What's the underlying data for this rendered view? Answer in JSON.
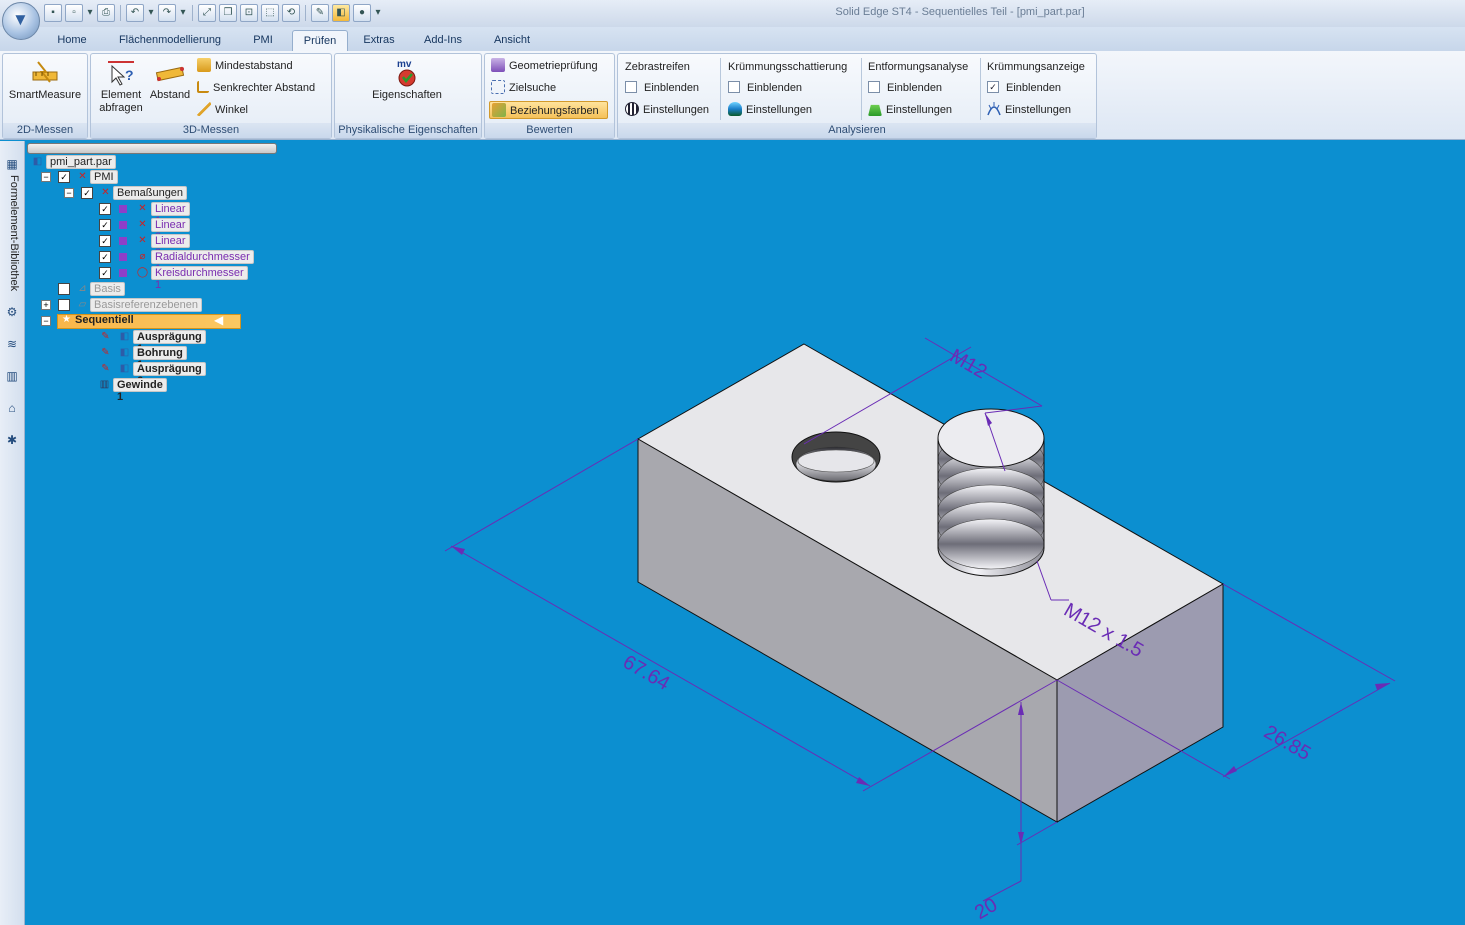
{
  "window": {
    "title": "Solid Edge ST4 - Sequentielles Teil - [pmi_part.par]"
  },
  "quick_access": [
    "save-icon",
    "save-as-icon",
    "dropdown-icon",
    "print-icon",
    "undo-icon",
    "redo-icon",
    "fit-icon",
    "window-icon",
    "zoom-icon",
    "view-icon",
    "sketch-icon",
    "part-icon",
    "stop-icon",
    "dropdown-icon"
  ],
  "tabs": [
    {
      "label": "Home"
    },
    {
      "label": "Flächenmodellierung"
    },
    {
      "label": "PMI"
    },
    {
      "label": "Prüfen"
    },
    {
      "label": "Extras"
    },
    {
      "label": "Add-Ins"
    },
    {
      "label": "Ansicht"
    }
  ],
  "ribbon": {
    "g2d": {
      "label": "2D-Messen",
      "smartmeasure": "SmartMeasure"
    },
    "g3d": {
      "label": "3D-Messen",
      "element1": "Element",
      "element2": "abfragen",
      "abstand": "Abstand",
      "mindestabstand": "Mindestabstand",
      "senkrecht": "Senkrechter Abstand",
      "winkel": "Winkel"
    },
    "gphys": {
      "label": "Physikalische Eigenschaften",
      "eigenschaften": "Eigenschaften",
      "icon_text": "mv"
    },
    "gbew": {
      "label": "Bewerten",
      "geometrie": "Geometrieprüfung",
      "zielsuche": "Zielsuche",
      "beziehung": "Beziehungsfarben"
    },
    "ganal": {
      "label": "Analysieren",
      "cols": [
        {
          "header": "Zebrastreifen",
          "show": "Einblenden",
          "settings": "Einstellungen",
          "checked": false
        },
        {
          "header": "Krümmungsschattierung",
          "show": "Einblenden",
          "settings": "Einstellungen",
          "checked": false
        },
        {
          "header": "Entformungsanalyse",
          "show": "Einblenden",
          "settings": "Einstellungen",
          "checked": false
        },
        {
          "header": "Krümmungsanzeige",
          "show": "Einblenden",
          "settings": "Einstellungen",
          "checked": true
        }
      ]
    }
  },
  "siderail": {
    "label": "Formelement-Bibliothek"
  },
  "tree": {
    "root": "pmi_part.par",
    "pmi": "PMI",
    "bemassungen": "Bemaßungen",
    "dims": [
      "Linear 1",
      "Linear 2",
      "Linear 3",
      "Radialdurchmesser 1",
      "Kreisdurchmesser 1"
    ],
    "basis": "Basis",
    "basisref": "Basisreferenzebenen",
    "sequentiell": "Sequentiell",
    "features": [
      "Ausprägung 1",
      "Bohrung 1",
      "Ausprägung 6"
    ],
    "gewinde": "Gewinde 1"
  },
  "dimensions": {
    "m12": "M12",
    "thread": "M12 x 1.5",
    "length": "67.64",
    "width": "26.85",
    "height": "20"
  },
  "colors": {
    "viewport_bg": "#0c8fd0",
    "dimension": "#6a2cb5",
    "highlight": "#fbc862"
  }
}
